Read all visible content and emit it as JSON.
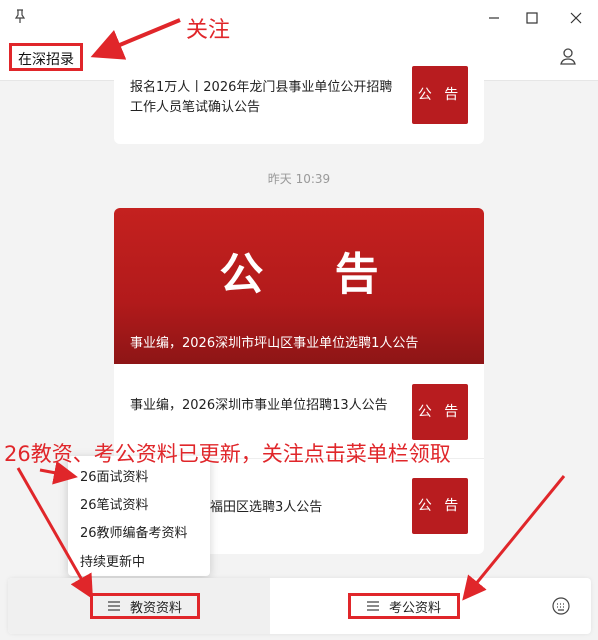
{
  "header": {
    "account_name": "在深招录"
  },
  "messages": {
    "card1_text": "报名1万人丨2026年龙门县事业单位公开招聘工作人员笔试确认公告",
    "thumb_label": "公 告",
    "timestamp": "昨天 10:39",
    "banner_title": "公 告",
    "banner_caption": "事业编，2026深圳市坪山区事业单位选聘1人公告",
    "card2_text": "事业编，2026深圳市事业单位招聘13人公告",
    "card3_text": "福田区选聘3人公告"
  },
  "popup_menu": {
    "items": [
      "26面试资料",
      "26笔试资料",
      "26教师编备考资料",
      "持续更新中"
    ]
  },
  "bottom_menu": {
    "left_label": "教资资料",
    "right_label": "考公资料"
  },
  "annotations": {
    "follow": "关注",
    "banner": "26教资、考公资料已更新，关注点击菜单栏领取"
  },
  "colors": {
    "annotation": "#e0262a",
    "thumb": "#b81c1f"
  }
}
